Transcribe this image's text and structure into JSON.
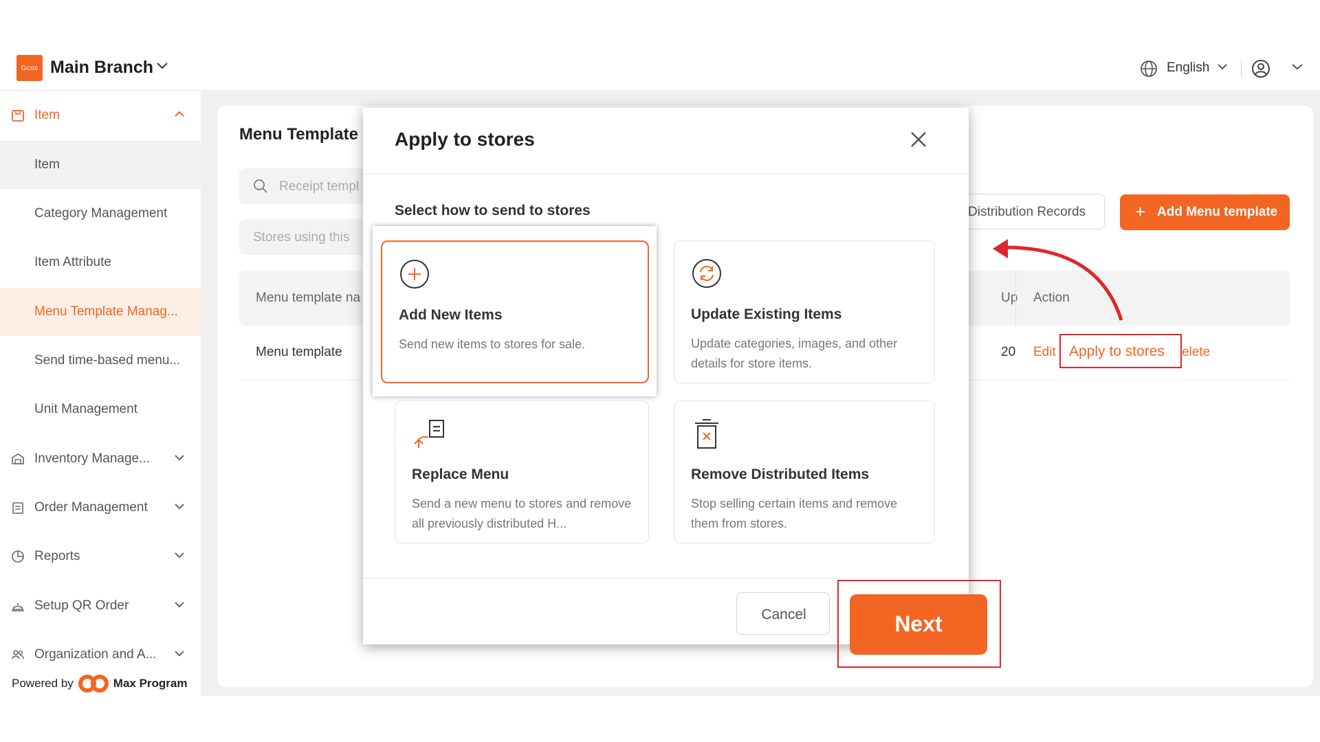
{
  "header": {
    "logo_text": "Gcos",
    "branch_title": "Main Branch",
    "language": "English"
  },
  "sidebar": {
    "items": [
      {
        "label": "Item",
        "icon": "box-icon",
        "expanded": true
      },
      {
        "label": "Inventory Manage...",
        "icon": "warehouse-icon"
      },
      {
        "label": "Order Management",
        "icon": "clipboard-icon"
      },
      {
        "label": "Reports",
        "icon": "pie-chart-icon"
      },
      {
        "label": "Setup QR Order",
        "icon": "service-bell-icon"
      },
      {
        "label": "Organization and A...",
        "icon": "people-icon"
      }
    ],
    "sub_items": [
      {
        "label": "Item"
      },
      {
        "label": "Category Management"
      },
      {
        "label": "Item Attribute"
      },
      {
        "label": "Menu Template Manag..."
      },
      {
        "label": "Send time-based menu..."
      },
      {
        "label": "Unit Management"
      }
    ],
    "powered_by": "Powered by",
    "powered_brand": "Max Program"
  },
  "main": {
    "title": "Menu Template",
    "search_placeholder": "Receipt templ",
    "stores_filter": "Stores using this",
    "distribution_records": "Distribution Records",
    "add_menu_template": "Add Menu template",
    "table": {
      "headers": {
        "name": "Menu template na",
        "updated": "Up",
        "action": "Action"
      },
      "rows": [
        {
          "name": "Menu template",
          "updated": "20",
          "edit": "Edit",
          "apply": "Apply to stores",
          "delete": "elete"
        }
      ]
    }
  },
  "modal": {
    "title": "Apply to stores",
    "subtitle": "Select how to send to stores",
    "options": [
      {
        "title": "Add New Items",
        "desc": "Send new items to stores for sale.",
        "icon": "plus-circle-icon",
        "selected": true
      },
      {
        "title": "Update Existing Items",
        "desc": "Update categories, images, and other details for store items.",
        "icon": "refresh-circle-icon"
      },
      {
        "title": "Replace Menu",
        "desc": "Send a new menu to stores and remove all previously distributed H...",
        "icon": "replace-doc-icon"
      },
      {
        "title": "Remove Distributed Items",
        "desc": "Stop selling certain items and remove them from stores.",
        "icon": "trash-x-icon"
      }
    ],
    "cancel": "Cancel",
    "next": "Next"
  },
  "colors": {
    "accent": "#f26522",
    "highlight_red": "#e0262c"
  }
}
